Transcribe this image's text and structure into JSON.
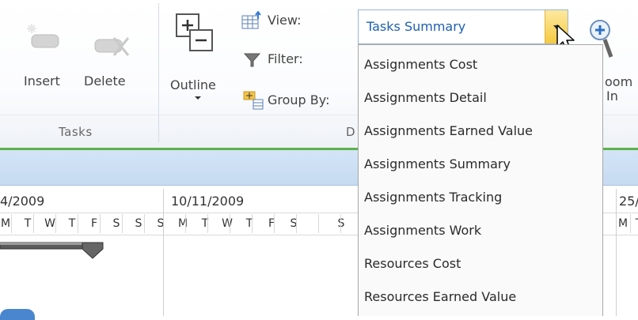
{
  "ribbon": {
    "tasks_group": {
      "insert_label": "Insert",
      "delete_label": "Delete",
      "group_label": "Tasks"
    },
    "outline_label": "Outline",
    "view_label": "View:",
    "filter_label": "Filter:",
    "group_by_label": "Group By:",
    "data_group_label": "D",
    "zoom_label_line1": "oom",
    "zoom_label_line2": "In",
    "view_value": "Tasks Summary"
  },
  "dropdown": {
    "items": [
      "Assignments Cost",
      "Assignments Detail",
      "Assignments Earned Value",
      "Assignments Summary",
      "Assignments Tracking",
      "Assignments Work",
      "Resources Cost",
      "Resources Earned Value"
    ]
  },
  "calendar": {
    "weeks": [
      "4/2009",
      "10/11/2009",
      "25/2"
    ],
    "week1_days": [
      "M",
      "T",
      "W",
      "T",
      "F",
      "S"
    ],
    "week2_days": [
      "S",
      "M",
      "T",
      "W",
      "T",
      "F",
      "S"
    ],
    "week3_days": [
      "M",
      "T"
    ]
  },
  "colors": {
    "accent_green": "#5db14a",
    "combo_highlight": "#f6c93e",
    "selected_text": "#1e5fae"
  }
}
